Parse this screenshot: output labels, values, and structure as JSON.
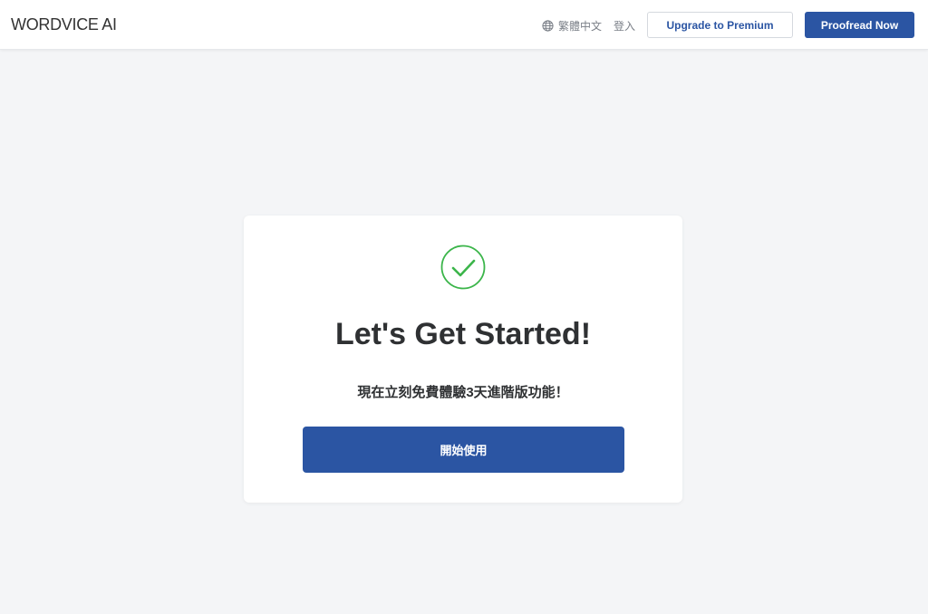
{
  "header": {
    "logo_text": "WORDVICE AI",
    "language_label": "繁體中文",
    "language_icon": "globe-icon",
    "login_label": "登入",
    "upgrade_label": "Upgrade to Premium",
    "proofread_label": "Proofread Now"
  },
  "card": {
    "status_icon": "check-circle-icon",
    "title": "Let's Get Started!",
    "subtitle": "現在立刻免費體驗3天進階版功能！",
    "button_label": "開始使用"
  },
  "colors": {
    "brand_blue": "#2b55a3",
    "success_green": "#3bb54a",
    "page_background": "#f4f5f7",
    "text_dark": "#2f3133",
    "text_muted": "#7a7f87"
  }
}
